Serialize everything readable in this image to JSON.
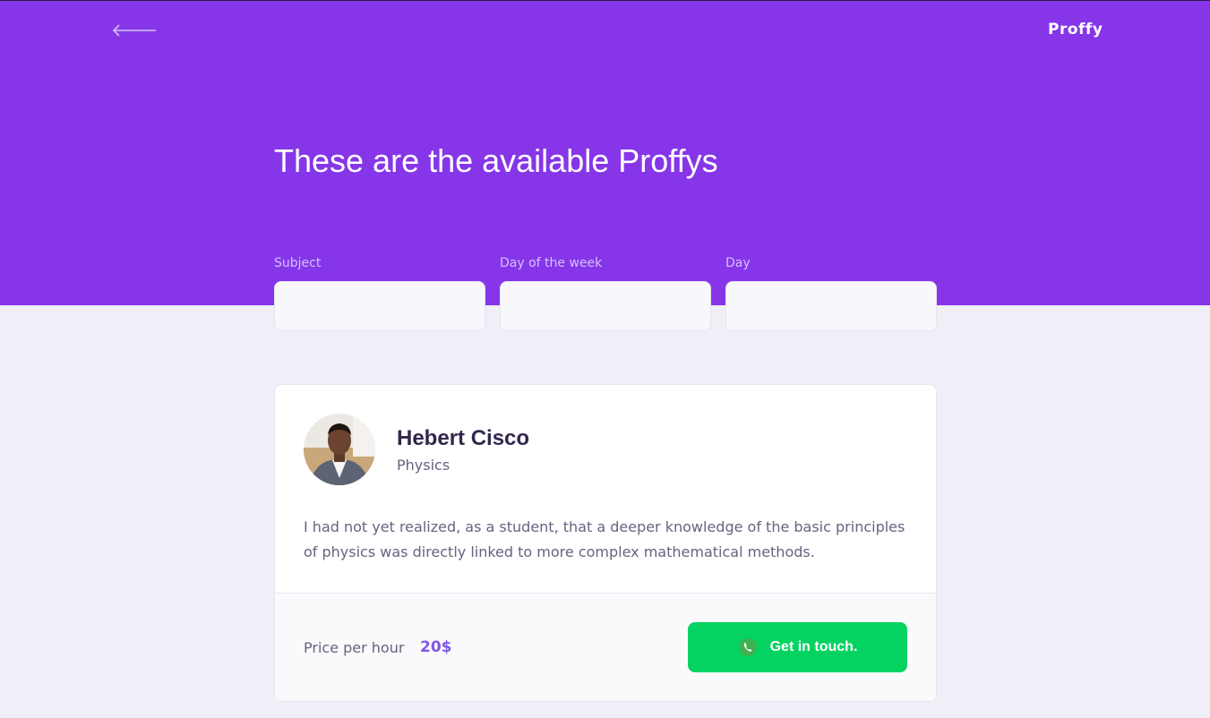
{
  "header": {
    "back_icon": "arrow-left-icon",
    "logo": "Proffy",
    "title": "These are the available Proffys",
    "background_color": "#8636e8"
  },
  "filters": [
    {
      "label": "Subject",
      "value": ""
    },
    {
      "label": "Day of the week",
      "value": ""
    },
    {
      "label": "Day",
      "value": ""
    }
  ],
  "teacher": {
    "name": "Hebert Cisco",
    "subject": "Physics",
    "bio": "I had not yet realized, as a student, that a deeper knowledge of the basic principles of physics was directly linked to more complex mathematical methods.",
    "price_label": "Price per hour",
    "price": "20$",
    "contact_label": "Get in touch.",
    "contact_icon": "whatsapp-icon",
    "accent_color": "#04d361"
  }
}
